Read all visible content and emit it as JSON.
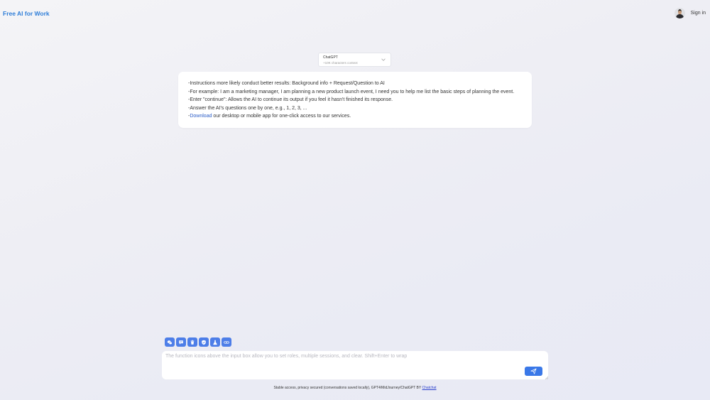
{
  "header": {
    "brand": "Free AI for Work",
    "signin_label": "Sign in"
  },
  "model_select": {
    "name": "ChatGPT",
    "context": "+10K characters context",
    "icon": "chevron-down-icon"
  },
  "info_card": {
    "lines": [
      "-Instructions more likely conduct better results: Background info + Request/Question to AI",
      "-For example: I am a marketing manager, I am planning a new product launch event, I need you to help me list the basic steps of planning the event.",
      "-Enter \"continue\": Allows the AI to continue its output if you feel it hasn't finished its response.",
      "-Answer the AI's questions one by one, e.g., 1, 2, 3, ..."
    ],
    "download_prefix": "-",
    "download_link": "Download",
    "download_suffix": " our desktop or mobile app for one-click access to our services."
  },
  "tools": [
    {
      "icon": "wechat-icon"
    },
    {
      "icon": "chat-bubble-icon"
    },
    {
      "icon": "trash-icon"
    },
    {
      "icon": "shield-icon"
    },
    {
      "icon": "flask-icon"
    },
    {
      "icon": "link-icon"
    }
  ],
  "composer": {
    "placeholder": "The function icons above the input box allow you to set roles, multiple sessions, and clear. Shift+Enter to wrap",
    "send_icon": "send-icon"
  },
  "footer": {
    "text": "Stable access, privacy secured (conversations saved locally), GPT4/MidJourney/ChatGPT BY ",
    "link": "Chatchat"
  },
  "colors": {
    "brand": "#2f7ed8",
    "tool_button": "#4d7ee8",
    "send_button": "#3a78e8",
    "link": "#2a5cc7"
  }
}
